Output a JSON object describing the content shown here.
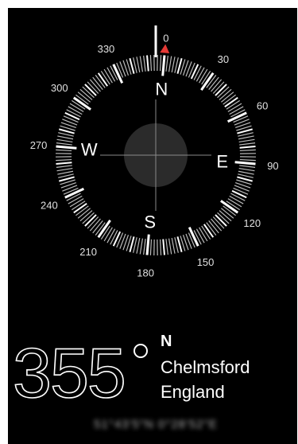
{
  "compass": {
    "heading_value": "355",
    "heading_direction": "N",
    "cardinal_labels": {
      "north": "N",
      "east": "E",
      "south": "S",
      "west": "W"
    },
    "degree_labels": [
      "0",
      "30",
      "60",
      "90",
      "120",
      "150",
      "180",
      "210",
      "240",
      "270",
      "300",
      "330"
    ],
    "heading_degrees": 355,
    "target_marker_color": "#e53935"
  },
  "location": {
    "line1": "Chelmsford",
    "line2": "England"
  },
  "coordinates": {
    "text": "51°43′5″N 0°28′52″E"
  }
}
